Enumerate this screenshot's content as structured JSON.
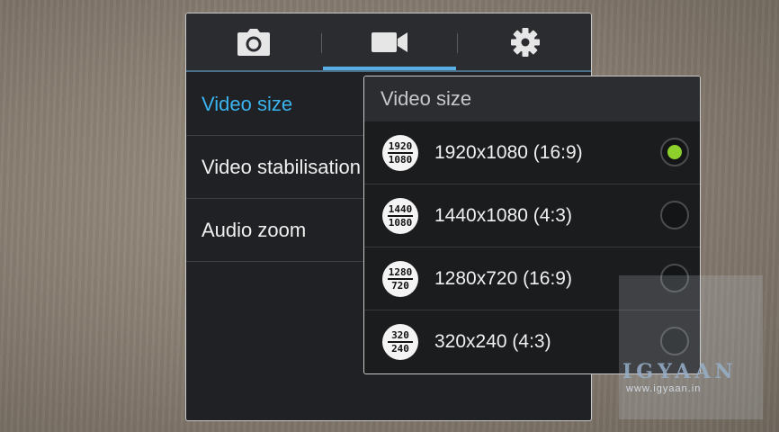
{
  "tabs": [
    {
      "name": "camera",
      "icon": "camera-icon"
    },
    {
      "name": "video",
      "icon": "video-camera-icon",
      "selected": true
    },
    {
      "name": "settings",
      "icon": "gear-icon"
    }
  ],
  "menu": {
    "items": [
      {
        "label": "Video size",
        "active": true
      },
      {
        "label": "Video stabilisation"
      },
      {
        "label": "Audio zoom"
      }
    ]
  },
  "popup": {
    "title": "Video size",
    "options": [
      {
        "icon_top": "1920",
        "icon_bottom": "1080",
        "label": "1920x1080 (16:9)",
        "selected": true
      },
      {
        "icon_top": "1440",
        "icon_bottom": "1080",
        "label": "1440x1080 (4:3)",
        "selected": false
      },
      {
        "icon_top": "1280",
        "icon_bottom": "720",
        "label": "1280x720 (16:9)",
        "selected": false
      },
      {
        "icon_top": "320",
        "icon_bottom": "240",
        "label": "320x240 (4:3)",
        "selected": false
      }
    ]
  },
  "watermark": {
    "brand": "IGYAAN",
    "site": "www.igyaan.in"
  },
  "colors": {
    "accent": "#3ab3ef",
    "radio_selected": "#8ed12d",
    "tab_indicator": "#5aaee6"
  }
}
